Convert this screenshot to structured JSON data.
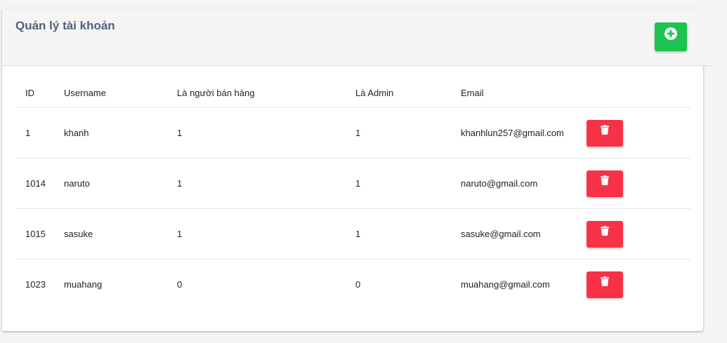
{
  "page": {
    "title": "Quản lý tài khoản"
  },
  "toolbar": {
    "add_icon": "plus-circle-icon"
  },
  "table": {
    "headers": {
      "id": "ID",
      "username": "Username",
      "seller": "Là người bán hàng",
      "admin": "Là Admin",
      "email": "Email"
    },
    "rows": [
      {
        "id": "1",
        "username": "khanh",
        "seller": "1",
        "admin": "1",
        "email": "khanhlun257@gmail.com"
      },
      {
        "id": "1014",
        "username": "naruto",
        "seller": "1",
        "admin": "1",
        "email": "naruto@gmail.com"
      },
      {
        "id": "1015",
        "username": "sasuke",
        "seller": "1",
        "admin": "1",
        "email": "sasuke@gmail.com"
      },
      {
        "id": "1023",
        "username": "muahang",
        "seller": "0",
        "admin": "0",
        "email": "muahang@gmail.com"
      }
    ],
    "delete_icon": "trash-icon"
  },
  "colors": {
    "add_button": "#1dc34f",
    "delete_button": "#f73247",
    "title": "#50607e",
    "header_bg": "#f5f5f5"
  }
}
